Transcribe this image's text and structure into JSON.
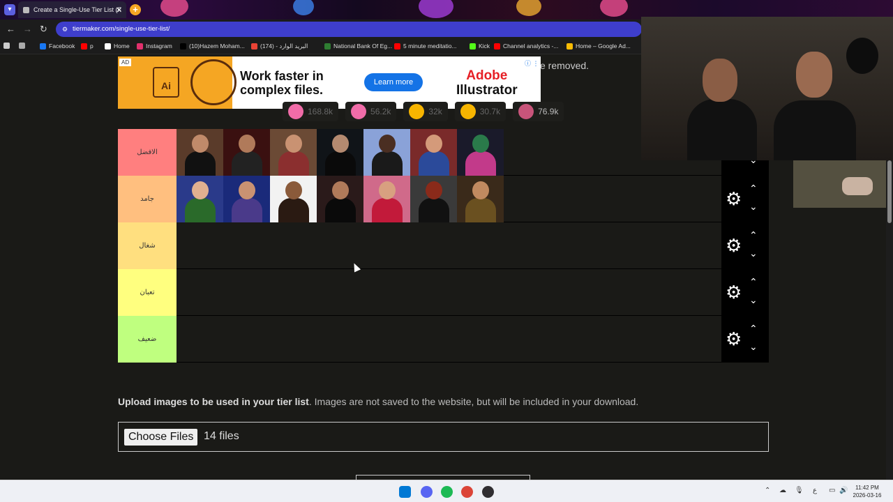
{
  "browser": {
    "tab_title": "Create a Single-Use Tier List (F",
    "close_glyph": "✕",
    "new_tab_glyph": "+",
    "back_glyph": "←",
    "forward_glyph": "→",
    "reload_glyph": "↻",
    "url": "tiermaker.com/single-use-tier-list/",
    "site_glyph": "⚙"
  },
  "bookmarks": [
    {
      "label": "Facebook",
      "color": "#1877f2",
      "icon": "facebook-icon"
    },
    {
      "label": "p",
      "color": "#ff0000",
      "icon": "youtube-icon"
    },
    {
      "label": "Home",
      "color": "#ffffff",
      "icon": "x-icon"
    },
    {
      "label": "Instagram",
      "color": "#e1306c",
      "icon": "instagram-icon"
    },
    {
      "label": "(10)Hazem Moham...",
      "color": "#000000",
      "icon": "tiktok-icon"
    },
    {
      "label": "(174) - البريد الوارد",
      "color": "#ea4335",
      "icon": "gmail-icon"
    },
    {
      "label": "National Bank Of Eg...",
      "color": "#2e7d32",
      "icon": "bank-icon"
    },
    {
      "label": "5 minute meditatio...",
      "color": "#ff0000",
      "icon": "youtube-icon"
    },
    {
      "label": "Kick",
      "color": "#53fc18",
      "icon": "kick-icon"
    },
    {
      "label": "Channel analytics -...",
      "color": "#ff0000",
      "icon": "youtube-icon"
    },
    {
      "label": "Home – Google Ad...",
      "color": "#fbbc04",
      "icon": "google-ads-icon"
    }
  ],
  "ad": {
    "tag": "AD",
    "headline": "Work faster in complex files.",
    "button": "Learn more",
    "brand_top": "Adobe",
    "brand_bottom": "Illustrator",
    "art_label": "Ai",
    "info_glyph": "ⓘ ⋮"
  },
  "removed_text": "e removed.",
  "reactions": [
    {
      "count": "168.8k",
      "color": "#f06ca8"
    },
    {
      "count": "56.2k",
      "color": "#f06ca8"
    },
    {
      "count": "32k",
      "color": "#f7b500"
    },
    {
      "count": "30.7k",
      "color": "#f7b500"
    },
    {
      "count": "76.9k",
      "color": "#c8547a"
    }
  ],
  "tiers": [
    {
      "label": "الافضل",
      "color": "#ff7f7f",
      "items": [
        {
          "name": "wrestler-1",
          "bg": "#5a3b2a",
          "skin": "#c08a6a",
          "outfit": "#111"
        },
        {
          "name": "wrestler-2",
          "bg": "#3a1010",
          "skin": "#b07a5a",
          "outfit": "#222"
        },
        {
          "name": "wrestler-3",
          "bg": "#6b4a35",
          "skin": "#c99272",
          "outfit": "#8b2f2f"
        },
        {
          "name": "wrestler-4",
          "bg": "#101418",
          "skin": "#b48a70",
          "outfit": "#0a0a0a"
        },
        {
          "name": "wrestler-5",
          "bg": "#8aa2d8",
          "skin": "#4a2e22",
          "outfit": "#1a1a1a"
        },
        {
          "name": "wrestler-6",
          "bg": "#7a2a2a",
          "skin": "#d49a7a",
          "outfit": "#2b4a9a"
        },
        {
          "name": "wrestler-7",
          "bg": "#1a1a2a",
          "skin": "#2a7a4a",
          "outfit": "#c23a8a"
        }
      ]
    },
    {
      "label": "جامد",
      "color": "#ffbf7f",
      "items": [
        {
          "name": "wrestler-8",
          "bg": "#2a3a8a",
          "skin": "#e0b090",
          "outfit": "#2a6a2a"
        },
        {
          "name": "wrestler-9",
          "bg": "#1a2a7a",
          "skin": "#c99272",
          "outfit": "#4a3a8a"
        },
        {
          "name": "wrestler-10",
          "bg": "#f2f2f2",
          "skin": "#8a5a3a",
          "outfit": "#2a1a12"
        },
        {
          "name": "wrestler-11",
          "bg": "#2a1a1a",
          "skin": "#b07a5a",
          "outfit": "#0a0a0a"
        },
        {
          "name": "wrestler-12",
          "bg": "#d06a8a",
          "skin": "#d8a080",
          "outfit": "#c21a3a"
        },
        {
          "name": "wrestler-13",
          "bg": "#3a3a3a",
          "skin": "#8a2a1a",
          "outfit": "#111"
        },
        {
          "name": "wrestler-14",
          "bg": "#3a2a1a",
          "skin": "#c08a60",
          "outfit": "#6a5020"
        }
      ]
    },
    {
      "label": "شغال",
      "color": "#ffdf7f",
      "items": []
    },
    {
      "label": "تعبان",
      "color": "#ffff7f",
      "items": []
    },
    {
      "label": "ضعيف",
      "color": "#bfff7f",
      "items": []
    }
  ],
  "tier_controls": {
    "gear": "⚙",
    "up": "⌃",
    "down": "⌄"
  },
  "upload": {
    "bold": "Upload images to be used in your tier list",
    "rest": ". Images are not saved to the website, but will be included in your download.",
    "button": "Choose Files",
    "count": "14 files"
  },
  "taskbar": {
    "time": "11:42 PM",
    "date": "2026-03-16",
    "lang": "ع",
    "icons": [
      {
        "name": "windows-start-icon",
        "color": "#0078d4"
      },
      {
        "name": "discord-icon",
        "color": "#5865f2"
      },
      {
        "name": "spotify-icon",
        "color": "#1db954"
      },
      {
        "name": "chrome-icon",
        "color": "#db4437"
      },
      {
        "name": "obs-icon",
        "color": "#302e31"
      }
    ]
  }
}
